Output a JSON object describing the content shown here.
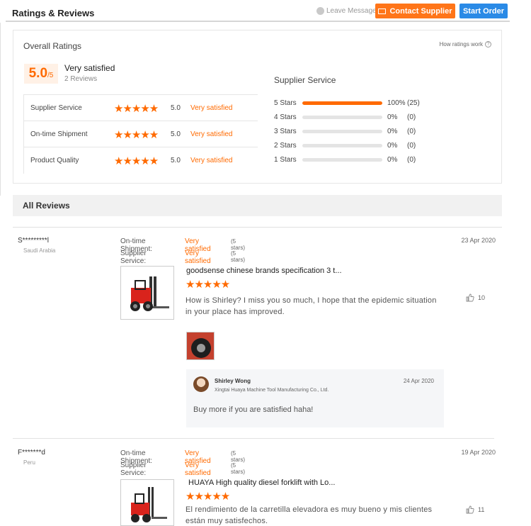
{
  "header": {
    "title": "Ratings & Reviews",
    "leave_messages": "Leave Messages",
    "contact_supplier": "Contact Supplier",
    "start_order": "Start Order"
  },
  "overall": {
    "title": "Overall Ratings",
    "how_link": "How ratings work",
    "score": "5.0",
    "score_suffix": "/5",
    "label": "Very satisfied",
    "count": "2 Reviews"
  },
  "dimensions": [
    {
      "label": "Supplier Service",
      "stars": 5,
      "score": "5.0",
      "text": "Very satisfied"
    },
    {
      "label": "On-time Shipment",
      "stars": 5,
      "score": "5.0",
      "text": "Very satisfied"
    },
    {
      "label": "Product Quality",
      "stars": 5,
      "score": "5.0",
      "text": "Very satisfied"
    }
  ],
  "supplier_service": {
    "title": "Supplier Service",
    "rows": [
      {
        "label": "5 Stars",
        "fraction": 1.0,
        "pct": "100%",
        "count": "(25)"
      },
      {
        "label": "4 Stars",
        "fraction": 0,
        "pct": "0%",
        "count": "(0)"
      },
      {
        "label": "3 Stars",
        "fraction": 0,
        "pct": "0%",
        "count": "(0)"
      },
      {
        "label": "2 Stars",
        "fraction": 0,
        "pct": "0%",
        "count": "(0)"
      },
      {
        "label": "1 Stars",
        "fraction": 0,
        "pct": "0%",
        "count": "(0)"
      }
    ]
  },
  "all_reviews": {
    "title": "All Reviews"
  },
  "reviews": [
    {
      "name": "S*********l",
      "country": "Saudi Arabia",
      "date": "23 Apr 2020",
      "shipment_label": "On-time Shipment:",
      "shipment_value": "Very satisfied",
      "shipment_stars": "(5 stars)",
      "service_label": "Supplier Service:",
      "service_value": "Very satisfied",
      "service_stars": "(5 stars)",
      "product_title": "goodsense chinese brands specification 3 t...",
      "rating": 5,
      "text_line1": "How is Shirley? I miss you so much, I hope that the epidemic situation",
      "text_line2": "in your place has improved.",
      "likes": "10",
      "reply": {
        "name": "Shirley Wong",
        "company": "Xingtai Huaya Machine Tool Manufacturing Co., Ltd.",
        "date": "24 Apr 2020",
        "text": "Buy more if you are satisfied haha!"
      }
    },
    {
      "name": "F*******d",
      "country": "Peru",
      "date": "19 Apr 2020",
      "shipment_label": "On-time Shipment:",
      "shipment_value": "Very satisfied",
      "shipment_stars": "(5 stars)",
      "service_label": "Supplier Service:",
      "service_value": "Very satisfied",
      "service_stars": "(5 stars)",
      "product_title": "HUAYA High quality diesel forklift with Lo...",
      "rating": 5,
      "text_line1": "El rendimiento de la carretilla elevadora es muy bueno y mis clientes",
      "text_line2": "están muy satisfechos.",
      "likes": "11"
    }
  ],
  "colors": {
    "accent": "#ff6a00",
    "blue": "#2a8ae6",
    "contact": "#ff7519"
  },
  "icons": [
    "message-icon",
    "envelope-icon",
    "help-icon",
    "star-icon",
    "thumbs-up-icon"
  ]
}
